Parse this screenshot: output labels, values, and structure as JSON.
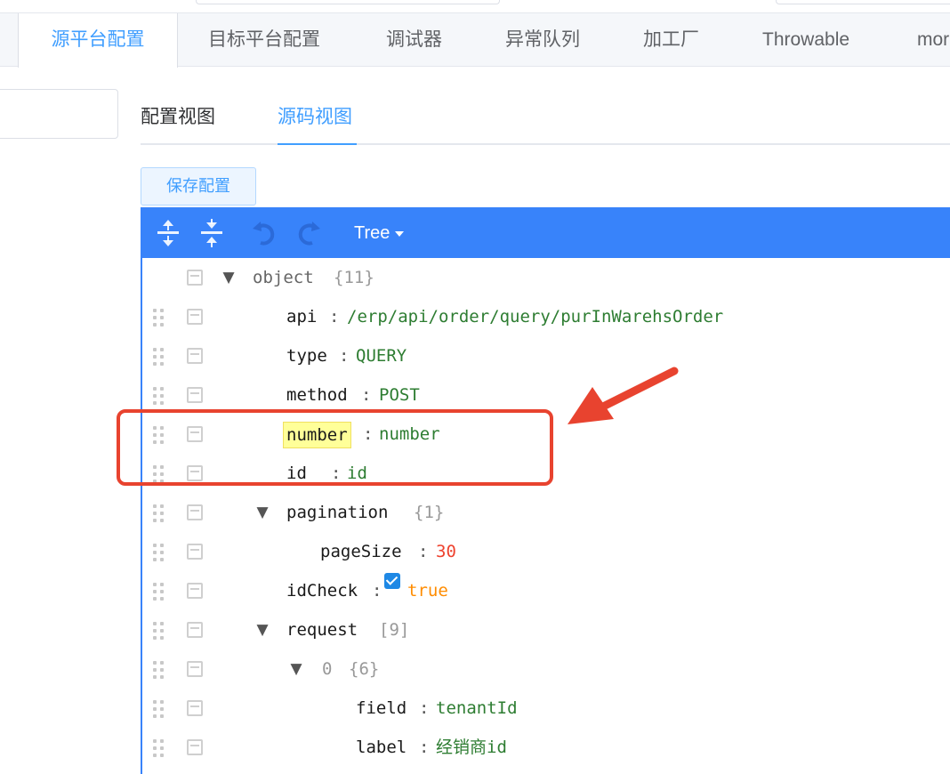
{
  "main_tabs": [
    {
      "label": "源平台配置",
      "active": true
    },
    {
      "label": "目标平台配置",
      "active": false
    },
    {
      "label": "调试器",
      "active": false
    },
    {
      "label": "异常队列",
      "active": false
    },
    {
      "label": "加工厂",
      "active": false
    },
    {
      "label": "Throwable",
      "active": false
    },
    {
      "label": "mor",
      "active": false
    }
  ],
  "view_tabs": [
    {
      "label": "配置视图",
      "active": false
    },
    {
      "label": "源码视图",
      "active": true
    }
  ],
  "save_button_label": "保存配置",
  "editor": {
    "mode_label": "Tree",
    "menu_icons": [
      "expand-all-icon",
      "collapse-all-icon",
      "undo-icon",
      "redo-icon"
    ],
    "accent_color": "#3883fa",
    "rows": [
      {
        "key": "object",
        "meta": "{11}",
        "expandable": true
      },
      {
        "key": "api",
        "value": "/erp/api/order/query/purInWarehsOrder",
        "type": "string"
      },
      {
        "key": "type",
        "value": "QUERY",
        "type": "string"
      },
      {
        "key": "method",
        "value": "POST",
        "type": "string"
      },
      {
        "key": "number",
        "value": "number",
        "type": "string",
        "highlighted": true
      },
      {
        "key": "id ",
        "value": "id",
        "type": "string"
      },
      {
        "key": "pagination",
        "meta": "{1}",
        "expandable": true
      },
      {
        "key": "pageSize",
        "value": "30",
        "type": "number"
      },
      {
        "key": "idCheck",
        "value": "true",
        "type": "boolean",
        "checked": true
      },
      {
        "key": "request",
        "meta": "[9]",
        "expandable": true
      },
      {
        "key": "0",
        "meta": "{6}",
        "expandable": true
      },
      {
        "key": "field",
        "value": "tenantId",
        "type": "string"
      },
      {
        "key": "label",
        "value": "经销商id",
        "type": "string"
      }
    ]
  },
  "annotation_color": "#e8432f"
}
